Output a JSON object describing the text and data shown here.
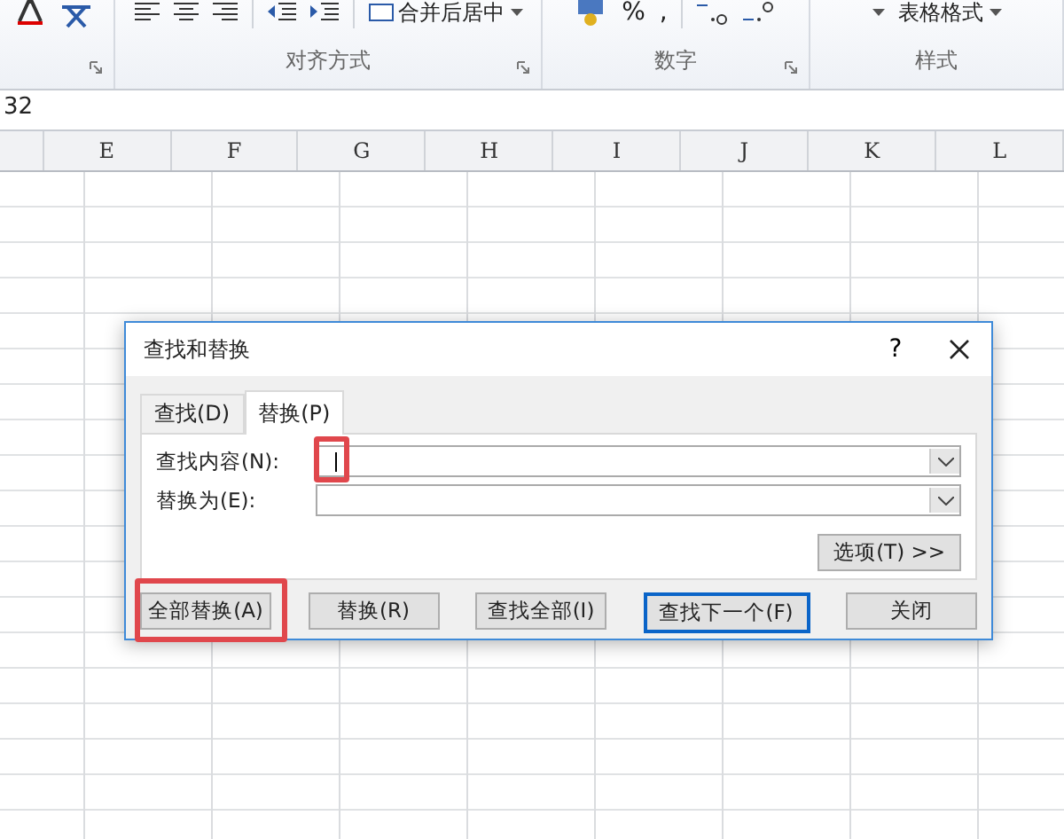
{
  "ribbon": {
    "merge_button": "合并后居中",
    "alignment_label": "对齐方式",
    "percent": "%",
    "comma": ",",
    "number_label": "数字",
    "table_format": "表格格式",
    "styles_label": "样式"
  },
  "formula_bar": {
    "value": "32"
  },
  "columns": [
    "E",
    "F",
    "G",
    "H",
    "I",
    "J",
    "K",
    "L"
  ],
  "dialog": {
    "title": "查找和替换",
    "help": "?",
    "tabs": [
      {
        "label": "查找(D)",
        "selected": false
      },
      {
        "label": "替换(P)",
        "selected": true
      }
    ],
    "fields": [
      {
        "label": "查找内容(N):",
        "focused": true,
        "highlight": true
      },
      {
        "label": "替换为(E):",
        "focused": false,
        "highlight": false
      }
    ],
    "options_button": "选项(T) >>",
    "buttons": [
      {
        "label": "全部替换(A)",
        "default": false,
        "highlight": true
      },
      {
        "label": "替换(R)",
        "default": false,
        "highlight": false
      },
      {
        "label": "查找全部(I)",
        "default": false,
        "highlight": false
      },
      {
        "label": "查找下一个(F)",
        "default": true,
        "highlight": false
      },
      {
        "label": "关闭",
        "default": false,
        "highlight": false
      }
    ]
  }
}
